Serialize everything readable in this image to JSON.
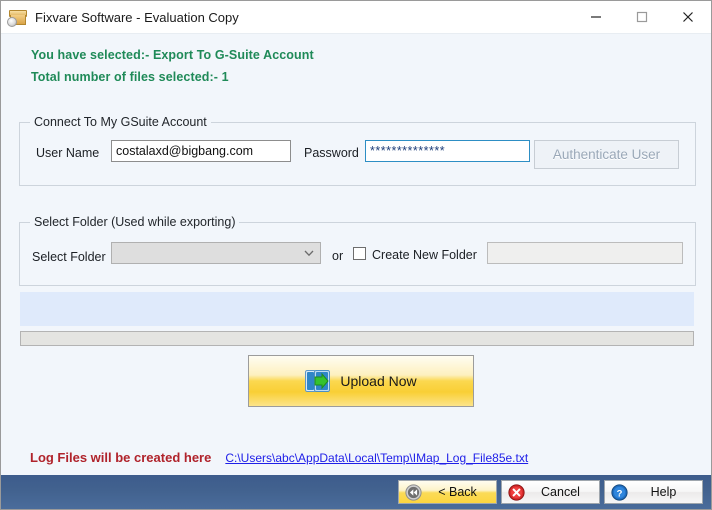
{
  "window": {
    "title": "Fixvare Software - Evaluation Copy",
    "app_icon": "archive-box-icon",
    "controls": {
      "minimize": "minimize-icon",
      "maximize": "maximize-icon",
      "close": "close-icon"
    }
  },
  "status": {
    "line1": "You have selected:- Export  To G-Suite Account",
    "line2": "Total number of files selected:- 1",
    "color": "#1f8a58"
  },
  "account_group": {
    "legend": "Connect To My GSuite Account",
    "username_label": "User Name",
    "username_value": "costalaxd@bigbang.com",
    "username_placeholder": "",
    "password_label": "Password",
    "password_value": "**************",
    "authenticate_label": "Authenticate User"
  },
  "folder_group": {
    "legend": "Select Folder (Used while exporting)",
    "select_label": "Select Folder",
    "select_value": "",
    "or_label": "or",
    "create_checkbox_label": "Create New Folder",
    "create_checkbox_checked": false,
    "new_folder_value": "",
    "new_folder_placeholder": ""
  },
  "progress": {
    "percent": 0,
    "log_text": ""
  },
  "upload": {
    "label": "Upload Now",
    "icon": "export-arrow-icon"
  },
  "log_files": {
    "lead": "Log Files will be created here",
    "path": "C:\\Users\\abc\\AppData\\Local\\Temp\\IMap_Log_File85e.txt",
    "lead_color": "#b0232b",
    "link_color": "#2020e8"
  },
  "footer": {
    "back_label": "< Back",
    "cancel_label": "Cancel",
    "help_label": "Help",
    "bar_color": "#42628f"
  }
}
